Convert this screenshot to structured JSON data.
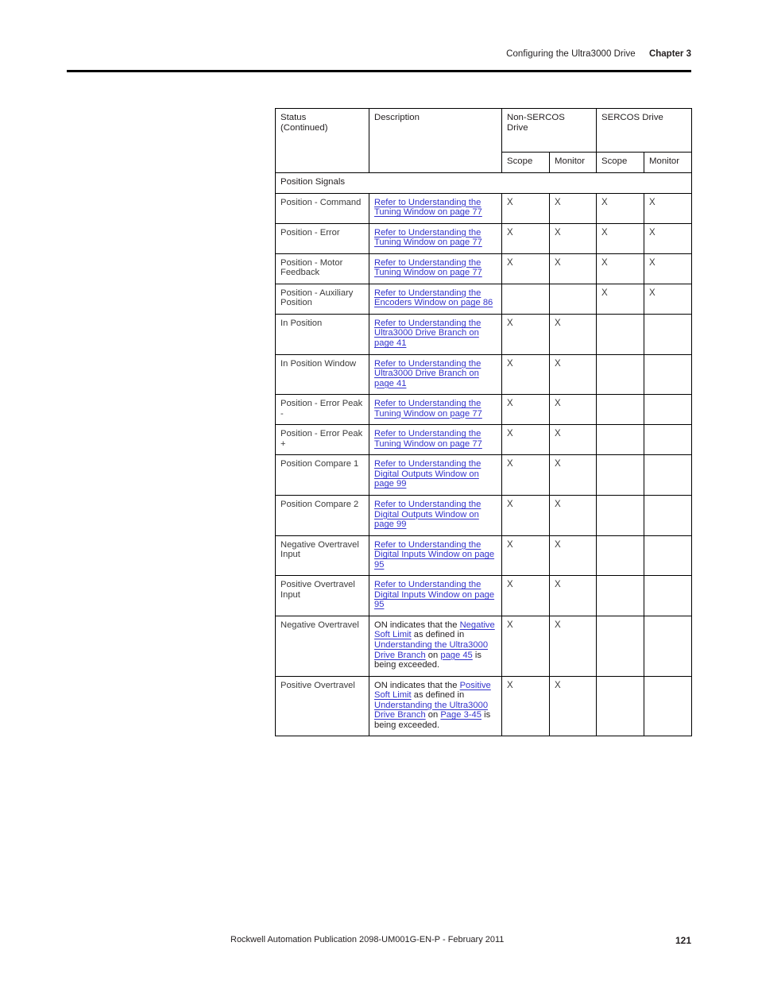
{
  "header": {
    "chapter_title": "Configuring the Ultra3000 Drive",
    "chapter_number": "Chapter 3"
  },
  "footer": {
    "publication": "Rockwell Automation Publication 2098-UM001G-EN-P  - February 2011",
    "page_number": "121"
  },
  "colors": {
    "link": "#3333CC",
    "text": "#231F20",
    "rule": "#000000"
  },
  "table": {
    "columns": [
      {
        "key": "status",
        "label_line1": "Status",
        "label_line2": "(Continued)"
      },
      {
        "key": "desc",
        "label_line1": "Description",
        "label_line2": ""
      },
      {
        "key": "nonsercos",
        "label_line1": "Non-SERCOS",
        "label_line2": "Drive"
      },
      {
        "key": "sercos",
        "label_line1": "SERCOS Drive",
        "label_line2": ""
      }
    ],
    "subheaders": {
      "non_sercos_scope": "Scope",
      "non_sercos_monitor": "Monitor",
      "sercos_scope": "Scope",
      "sercos_monitor": "Monitor"
    },
    "section_label": "Position Signals",
    "mark": "X",
    "rows": [
      {
        "status": "Position - Command",
        "desc_parts": [
          {
            "text": "Refer to Understanding the Tuning Window on page 77",
            "link": true
          }
        ],
        "non_sercos_scope": "X",
        "non_sercos_monitor": "X",
        "sercos_scope": "X",
        "sercos_monitor": "X"
      },
      {
        "status": "Position - Error",
        "desc_parts": [
          {
            "text": "Refer to Understanding the Tuning Window on page 77",
            "link": true
          }
        ],
        "non_sercos_scope": "X",
        "non_sercos_monitor": "X",
        "sercos_scope": "X",
        "sercos_monitor": "X"
      },
      {
        "status": "Position - Motor Feedback",
        "desc_parts": [
          {
            "text": "Refer to Understanding the Tuning Window on page 77",
            "link": true
          }
        ],
        "non_sercos_scope": "X",
        "non_sercos_monitor": "X",
        "sercos_scope": "X",
        "sercos_monitor": "X"
      },
      {
        "status": "Position - Auxiliary Position",
        "desc_parts": [
          {
            "text": "Refer to Understanding the Encoders Window on page 86",
            "link": true
          }
        ],
        "non_sercos_scope": "",
        "non_sercos_monitor": "",
        "sercos_scope": "X",
        "sercos_monitor": "X"
      },
      {
        "status": "In Position",
        "desc_parts": [
          {
            "text": "Refer to Understanding the Ultra3000 Drive Branch on page 41",
            "link": true
          }
        ],
        "non_sercos_scope": "X",
        "non_sercos_monitor": "X",
        "sercos_scope": "",
        "sercos_monitor": ""
      },
      {
        "status": "In Position Window",
        "desc_parts": [
          {
            "text": "Refer to Understanding the Ultra3000 Drive Branch on page 41",
            "link": true
          }
        ],
        "non_sercos_scope": "X",
        "non_sercos_monitor": "X",
        "sercos_scope": "",
        "sercos_monitor": ""
      },
      {
        "status": "Position - Error Peak -",
        "desc_parts": [
          {
            "text": "Refer to Understanding the Tuning Window on page 77",
            "link": true
          }
        ],
        "non_sercos_scope": "X",
        "non_sercos_monitor": "X",
        "sercos_scope": "",
        "sercos_monitor": ""
      },
      {
        "status": "Position - Error Peak +",
        "desc_parts": [
          {
            "text": "Refer to Understanding the Tuning Window on page 77",
            "link": true
          }
        ],
        "non_sercos_scope": "X",
        "non_sercos_monitor": "X",
        "sercos_scope": "",
        "sercos_monitor": ""
      },
      {
        "status": "Position Compare 1",
        "desc_parts": [
          {
            "text": "Refer to Understanding the Digital Outputs Window on page 99",
            "link": true
          }
        ],
        "non_sercos_scope": "X",
        "non_sercos_monitor": "X",
        "sercos_scope": "",
        "sercos_monitor": ""
      },
      {
        "status": "Position Compare 2",
        "desc_parts": [
          {
            "text": "Refer to Understanding the Digital Outputs Window on page 99",
            "link": true
          }
        ],
        "non_sercos_scope": "X",
        "non_sercos_monitor": "X",
        "sercos_scope": "",
        "sercos_monitor": ""
      },
      {
        "status": "Negative Overtravel Input",
        "desc_parts": [
          {
            "text": "Refer to Understanding the Digital Inputs Window on page 95",
            "link": true
          }
        ],
        "non_sercos_scope": "X",
        "non_sercos_monitor": "X",
        "sercos_scope": "",
        "sercos_monitor": ""
      },
      {
        "status": "Positive Overtravel Input",
        "desc_parts": [
          {
            "text": "Refer to Understanding the Digital Inputs Window on page 95",
            "link": true
          }
        ],
        "non_sercos_scope": "X",
        "non_sercos_monitor": "X",
        "sercos_scope": "",
        "sercos_monitor": ""
      },
      {
        "status": "Negative Overtravel",
        "desc_parts": [
          {
            "text": "ON indicates that the ",
            "link": false
          },
          {
            "text": "Negative Soft Limit",
            "link": true
          },
          {
            "text": " as defined in ",
            "link": false
          },
          {
            "text": "Understanding the Ultra3000 Drive Branch",
            "link": true
          },
          {
            "text": " on ",
            "link": false
          },
          {
            "text": "page 45",
            "link": true
          },
          {
            "text": " is being exceeded.",
            "link": false
          }
        ],
        "non_sercos_scope": "X",
        "non_sercos_monitor": "X",
        "sercos_scope": "",
        "sercos_monitor": ""
      },
      {
        "status": "Positive Overtravel",
        "desc_parts": [
          {
            "text": "ON indicates that the ",
            "link": false
          },
          {
            "text": "Positive Soft Limit",
            "link": true
          },
          {
            "text": " as defined in ",
            "link": false
          },
          {
            "text": "Understanding the Ultra3000 Drive Branch",
            "link": true
          },
          {
            "text": " on ",
            "link": false
          },
          {
            "text": "Page 3-45",
            "link": true
          },
          {
            "text": " is being exceeded.",
            "link": false
          }
        ],
        "non_sercos_scope": "X",
        "non_sercos_monitor": "X",
        "sercos_scope": "",
        "sercos_monitor": ""
      }
    ]
  }
}
